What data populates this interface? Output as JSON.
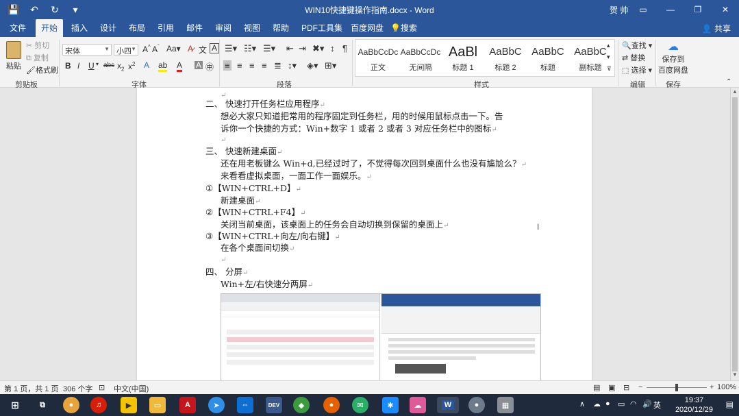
{
  "window": {
    "title": "WIN10快捷键操作指南.docx  -  Word",
    "user": "贺 帅",
    "min": "—",
    "restore": "❐",
    "close": "✕",
    "ribbon_opt": "▭"
  },
  "quick_access": {
    "save": "💾",
    "undo": "↶",
    "redo": "↻",
    "more": "▾"
  },
  "tabs": [
    "文件",
    "开始",
    "插入",
    "设计",
    "布局",
    "引用",
    "邮件",
    "审阅",
    "视图",
    "帮助",
    "PDF工具集",
    "百度网盘",
    "搜索"
  ],
  "share": "共享",
  "clipboard": {
    "paste": "粘贴",
    "cut": "剪切",
    "copy": "复制",
    "format_painter": "格式刷",
    "label": "剪贴板"
  },
  "font": {
    "name": "宋体",
    "size": "小四",
    "label": "字体"
  },
  "paragraph": {
    "label": "段落"
  },
  "styles": {
    "label": "样式",
    "items": [
      {
        "preview": "AaBbCcDc",
        "name": "正文"
      },
      {
        "preview": "AaBbCcDc",
        "name": "无间隔"
      },
      {
        "preview": "AaBl",
        "name": "标题 1"
      },
      {
        "preview": "AaBbC",
        "name": "标题 2"
      },
      {
        "preview": "AaBbC",
        "name": "标题"
      },
      {
        "preview": "AaBbC",
        "name": "副标题"
      }
    ]
  },
  "editing": {
    "find": "查找",
    "replace": "替换",
    "select": "选择",
    "label": "编辑"
  },
  "save_group": {
    "save_to": "保存到",
    "baidu": "百度网盘",
    "label": "保存"
  },
  "document": {
    "lines": [
      "二、    快速打开任务栏应用程序",
      "想必大家只知道把常用的程序固定到任务栏，用的时候用鼠标点击一下。告",
      "诉你一个快捷的方式：Win+数字 1 或者 2 或者 3 对应任务栏中的图标",
      "三、    快速新建桌面",
      "还在用老板键么 Win+d,已经过时了，不觉得每次回到桌面什么也没有尴尬么？",
      "来看看虚拟桌面，一面工作一面娱乐。",
      "①【WIN+CTRL+D】",
      "新建桌面",
      "②【WIN+CTRL+F4】",
      "关闭当前桌面，该桌面上的任务会自动切换到保留的桌面上",
      "③【WIN+CTRL+向左/向右键】",
      "在各个桌面间切换",
      "四、    分屏",
      "Win+左/右快速分两屏"
    ],
    "para_mark": "↵"
  },
  "status": {
    "page": "第 1 页，共 1 页",
    "words": "306 个字",
    "lang": "中文(中国)",
    "zoom": "100%"
  },
  "taskbar": {
    "time": "19:37",
    "date": "2020/12/29",
    "icons": [
      "start-icon",
      "task-view-icon",
      "chrome-icon",
      "netease-music-icon",
      "potplayer-icon",
      "file-explorer-icon",
      "acrobat-icon",
      "feishu-icon",
      "teamviewer-icon",
      "devtools-icon",
      "app-icon",
      "firefox-icon",
      "wechat-icon",
      "remote-icon",
      "cloud-icon",
      "word-icon",
      "app2-icon",
      "app3-icon"
    ]
  }
}
